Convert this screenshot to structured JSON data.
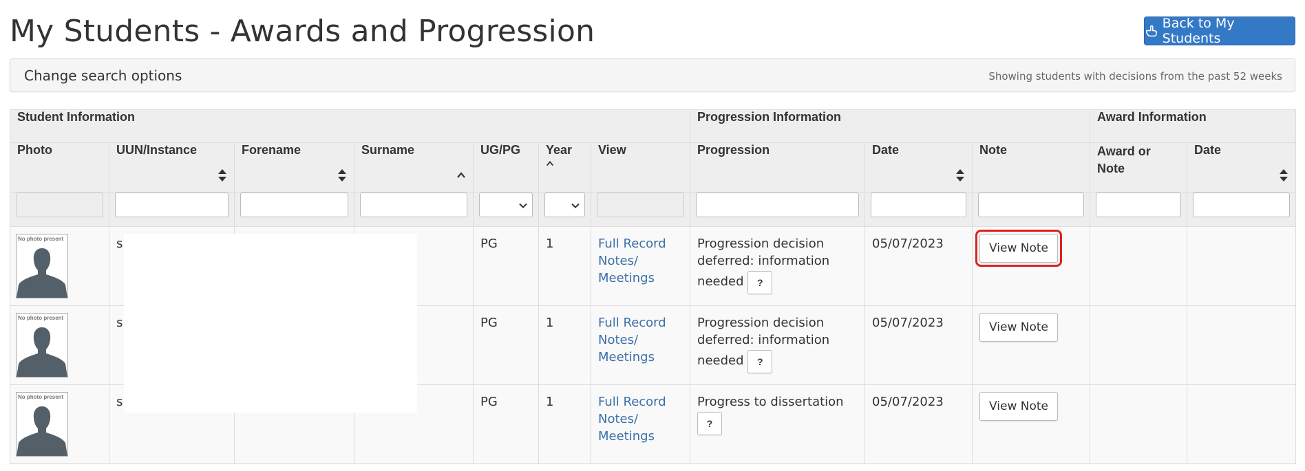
{
  "page": {
    "title": "My Students - Awards and Progression",
    "back_button_label": "Back to My Students"
  },
  "search": {
    "toggle_label": "Change search options",
    "info_text": "Showing students with decisions from the past 52 weeks"
  },
  "table": {
    "groups": {
      "student": "Student Information",
      "progression": "Progression Information",
      "award": "Award Information"
    },
    "columns": {
      "photo": "Photo",
      "uun": "UUN/Instance",
      "forename": "Forename",
      "surname": "Surname",
      "ugpg": "UG/PG",
      "year": "Year",
      "view": "View",
      "progression": "Progression",
      "prog_date": "Date",
      "note": "Note",
      "award_line1": "Award or",
      "award_line2": "Note",
      "award_date": "Date"
    },
    "photo_caption": "No photo present",
    "rows": [
      {
        "uun": "s",
        "ugpg": "PG",
        "year": "1",
        "link_full_record": "Full Record",
        "link_notes_line1": "Notes/",
        "link_notes_line2": "Meetings",
        "progression": "Progression decision deferred: information needed",
        "help_label": "?",
        "date": "05/07/2023",
        "note_button": "View Note",
        "highlighted": true
      },
      {
        "uun": "s",
        "ugpg": "PG",
        "year": "1",
        "link_full_record": "Full Record",
        "link_notes_line1": "Notes/",
        "link_notes_line2": "Meetings",
        "progression": "Progression decision deferred: information needed",
        "help_label": "?",
        "date": "05/07/2023",
        "note_button": "View Note",
        "highlighted": false
      },
      {
        "uun": "s",
        "ugpg": "PG",
        "year": "1",
        "link_full_record": "Full Record",
        "link_notes_line1": "Notes/",
        "link_notes_line2": "Meetings",
        "progression": "Progress to dissertation",
        "help_label": "?",
        "date": "05/07/2023",
        "note_button": "View Note",
        "highlighted": false
      }
    ]
  },
  "colors": {
    "primary_button": "#3479c6",
    "link": "#3b6fa8",
    "highlight": "#e02020",
    "header_bg": "#eeeeee"
  }
}
